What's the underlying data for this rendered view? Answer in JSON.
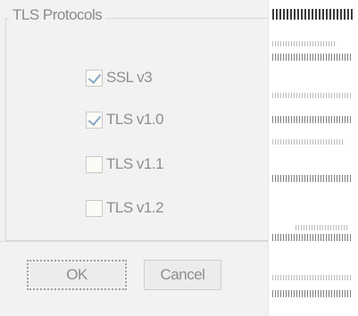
{
  "dialog": {
    "group_title": "TLS Protocols",
    "options": [
      {
        "label": "SSL v3",
        "checked": true
      },
      {
        "label": "TLS v1.0",
        "checked": true
      },
      {
        "label": "TLS v1.1",
        "checked": false
      },
      {
        "label": "TLS v1.2",
        "checked": false
      }
    ],
    "ok_label": "OK",
    "cancel_label": "Cancel"
  },
  "colors": {
    "panel_background": "#f2f2f2",
    "checkmark": "#8aa8c8",
    "text": "#8e8e8e"
  }
}
